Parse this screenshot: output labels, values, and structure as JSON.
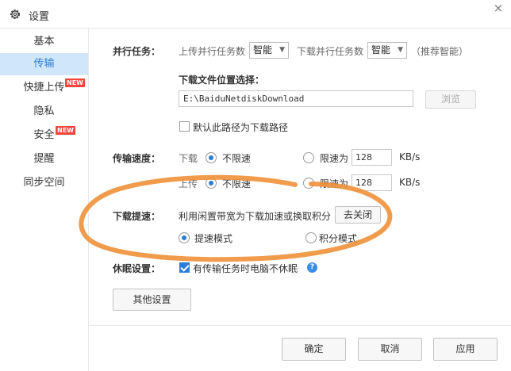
{
  "window": {
    "title": "设置",
    "close": "×"
  },
  "sidebar": {
    "items": [
      {
        "label": "基本"
      },
      {
        "label": "传输"
      },
      {
        "label": "快捷上传",
        "badge": "NEW"
      },
      {
        "label": "隐私"
      },
      {
        "label": "安全",
        "badge": "NEW"
      },
      {
        "label": "提醒"
      },
      {
        "label": "同步空间"
      }
    ]
  },
  "parallel": {
    "label": "并行任务：",
    "upload_label": "上传并行任务数",
    "upload_value": "智能",
    "download_label": "下载并行任务数",
    "download_value": "智能",
    "hint": "（推荐智能）"
  },
  "download_location": {
    "label": "下载文件位置选择：",
    "path": "E:\\BaiduNetdiskDownload",
    "browse": "浏览",
    "default_check": "默认此路径为下载路径"
  },
  "speed": {
    "label": "传输速度：",
    "download_label": "下载",
    "upload_label": "上传",
    "unlimited": "不限速",
    "limit_to": "限速为",
    "download_limit": "128",
    "upload_limit": "128",
    "unit": "KB/s"
  },
  "accelerate": {
    "label": "下载提速：",
    "desc": "利用闲置带宽为下载加速或换取积分",
    "close_button": "去关闭",
    "mode_speed": "提速模式",
    "mode_points": "积分模式"
  },
  "sleep": {
    "label": "休眠设置：",
    "check": "有传输任务时电脑不休眠",
    "help": "?"
  },
  "other_settings": "其他设置",
  "footer": {
    "ok": "确定",
    "cancel": "取消",
    "apply": "应用"
  },
  "colors": {
    "accent": "#2d7dd2",
    "active_bg": "#cfe6fb",
    "badge": "#f2453d",
    "annotation": "#f0903a"
  }
}
